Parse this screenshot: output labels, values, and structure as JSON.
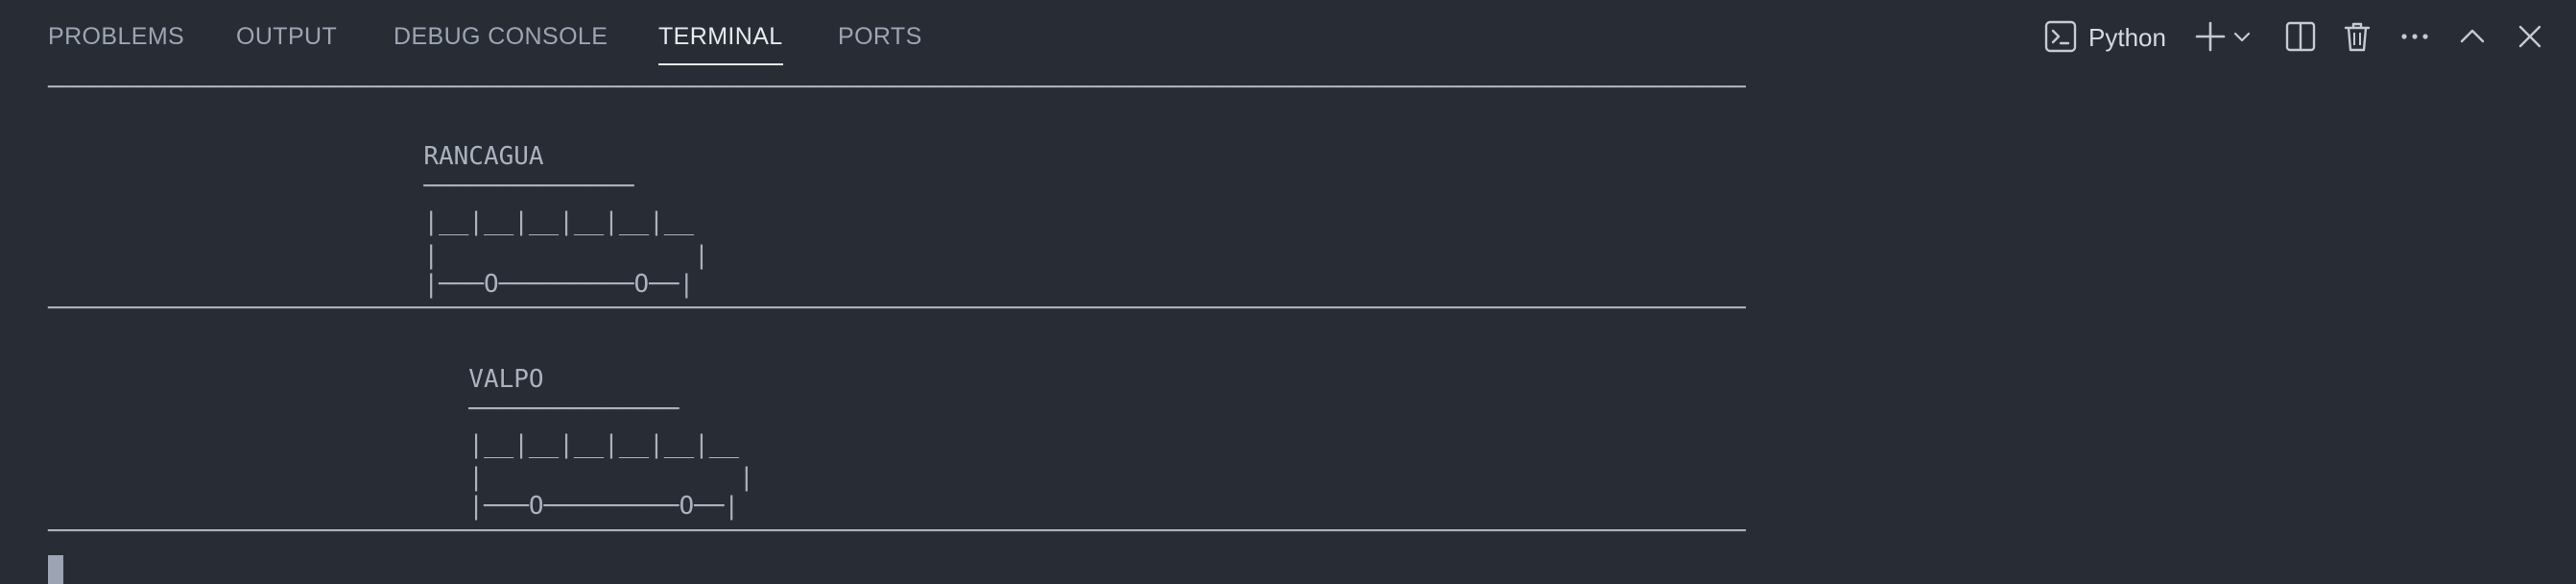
{
  "tabs": [
    {
      "label": "PROBLEMS"
    },
    {
      "label": "OUTPUT"
    },
    {
      "label": "DEBUG CONSOLE"
    },
    {
      "label": "TERMINAL"
    },
    {
      "label": "PORTS"
    }
  ],
  "active_tab": "TERMINAL",
  "toolbar": {
    "profile_label": "Python",
    "icons": [
      "terminal-icon",
      "plus-icon",
      "chevron-down-icon",
      "split-editor-icon",
      "trash-icon",
      "ellipsis-icon",
      "chevron-up-icon",
      "close-icon"
    ]
  },
  "terminal": {
    "lines": [
      "─────────────────────────────────────────────────────────────────────────────────────────────────────────────────",
      "",
      "                         RANCAGUA",
      "                         ──────────────",
      "                         |__|__|__|__|__|__",
      "                         |                 |",
      "                         |───O─────────O──|",
      "─────────────────────────────────────────────────────────────────────────────────────────────────────────────────",
      "",
      "                            VALPO",
      "                            ──────────────",
      "                            |__|__|__|__|__|__",
      "                            |                 |",
      "                            |───O─────────O──|",
      "─────────────────────────────────────────────────────────────────────────────────────────────────────────────────"
    ]
  },
  "colors": {
    "background": "#282c34",
    "text": "#abb2bf",
    "active_tab": "#e6e9ee",
    "inactive_tab": "#9da5b4"
  }
}
